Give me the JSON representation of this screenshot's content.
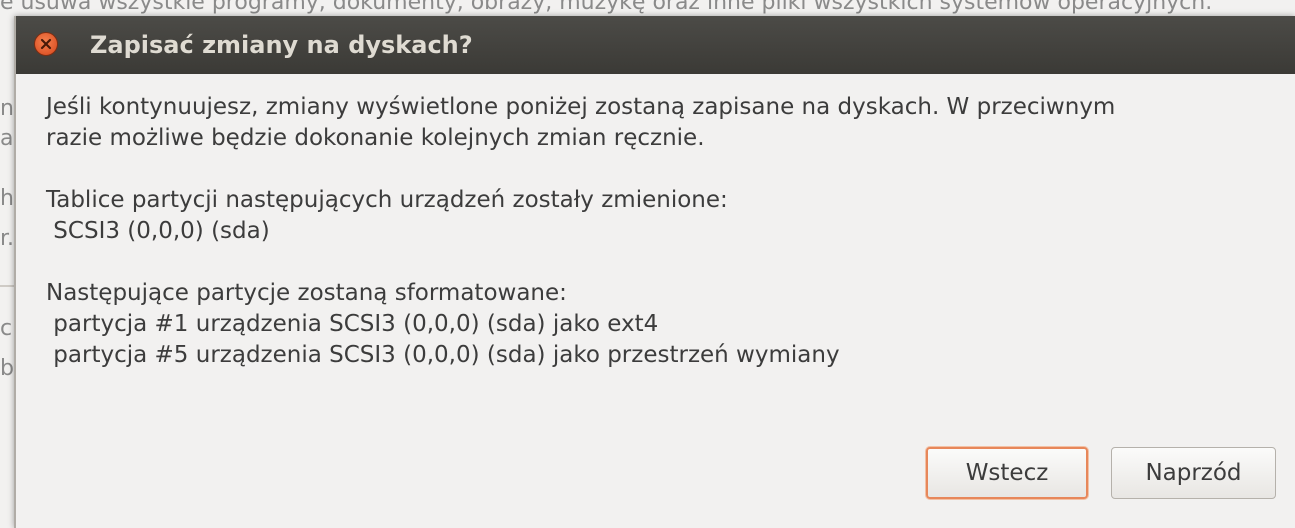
{
  "background": {
    "text_top": "e usuwa wszystkie programy, dokumenty, obrazy, muzykę oraz inne pliki wszystkich systemów operacyjnych.",
    "left_fragments": [
      "n",
      "a",
      "h",
      "r.",
      "c",
      "ba"
    ]
  },
  "dialog": {
    "title": "Zapisać zmiany na dyskach?",
    "paragraph1": [
      "Jeśli kontynuujesz, zmiany wyświetlone poniżej zostaną zapisane na dyskach. W przeciwnym",
      "razie możliwe będzie dokonanie kolejnych zmian ręcznie."
    ],
    "paragraph2": [
      "Tablice partycji następujących urządzeń zostały zmienione:",
      " SCSI3 (0,0,0) (sda)"
    ],
    "paragraph3": [
      "Następujące partycje zostaną sformatowane:",
      " partycja #1 urządzenia SCSI3 (0,0,0) (sda) jako ext4",
      " partycja #5 urządzenia SCSI3 (0,0,0) (sda) jako przestrzeń wymiany"
    ],
    "buttons": {
      "back_label": "Wstecz",
      "next_label": "Naprzód"
    }
  },
  "colors": {
    "titlebar": "#3c3b37",
    "title_text": "#dfdbd2",
    "close_button": "#e5572a",
    "focus_ring": "#e7875a",
    "body_text": "#3c3c3c"
  }
}
